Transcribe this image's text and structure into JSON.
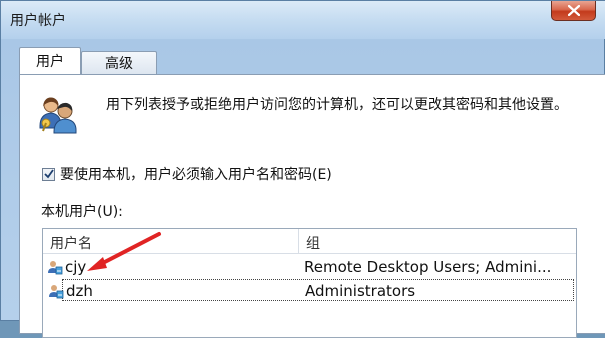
{
  "window": {
    "title": "用户帐户"
  },
  "tabs": [
    {
      "label": "用户",
      "active": true
    },
    {
      "label": "高级",
      "active": false
    }
  ],
  "description": "用下列表授予或拒绝用户访问您的计算机，还可以更改其密码和其他设置。",
  "checkbox": {
    "label": "要使用本机，用户必须输入用户名和密码(E)",
    "checked": true
  },
  "users_section_label": "本机用户(U):",
  "list": {
    "columns": [
      "用户名",
      "组"
    ],
    "rows": [
      {
        "name": "cjy",
        "group": "Remote Desktop Users; Admini..."
      },
      {
        "name": "dzh",
        "group": "Administrators"
      }
    ]
  },
  "colors": {
    "annotation_arrow": "#e02424",
    "close_button": "#c33a1c"
  }
}
